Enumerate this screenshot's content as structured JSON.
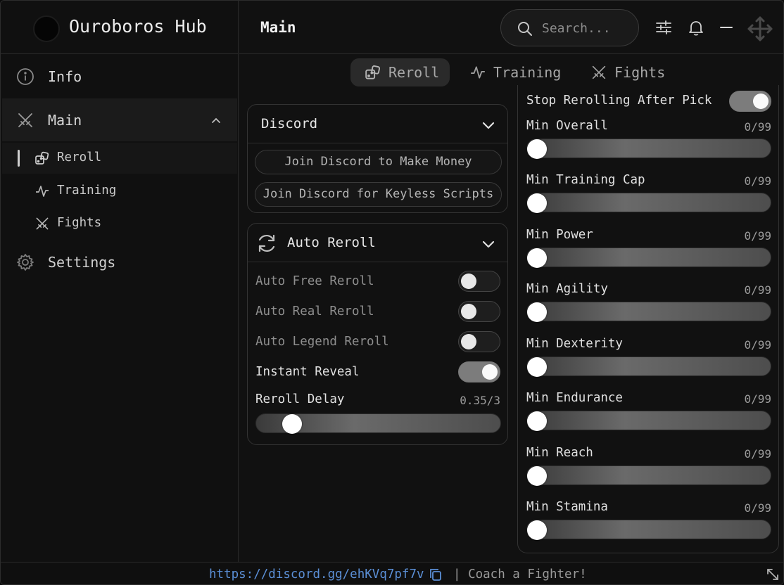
{
  "app": {
    "title": "Ouroboros Hub"
  },
  "header": {
    "title": "Main",
    "search_placeholder": "Search..."
  },
  "sidebar": {
    "items": [
      {
        "label": "Info"
      },
      {
        "label": "Main"
      },
      {
        "label": "Settings"
      }
    ],
    "sub_items": [
      {
        "label": "Reroll"
      },
      {
        "label": "Training"
      },
      {
        "label": "Fights"
      }
    ]
  },
  "tabs": [
    {
      "label": "Reroll",
      "active": true
    },
    {
      "label": "Training"
    },
    {
      "label": "Fights"
    }
  ],
  "discord_panel": {
    "title": "Discord",
    "buttons": [
      "Join Discord to Make Money",
      "Join Discord for Keyless Scripts"
    ]
  },
  "auto_reroll_panel": {
    "title": "Auto Reroll",
    "toggles": [
      {
        "label": "Auto Free Reroll",
        "on": false
      },
      {
        "label": "Auto Real Reroll",
        "on": false
      },
      {
        "label": "Auto Legend Reroll",
        "on": false
      },
      {
        "label": "Instant Reveal",
        "on": true
      }
    ],
    "slider": {
      "label": "Reroll Delay",
      "value_text": "0.35/3",
      "value": 0.35,
      "max": 3
    }
  },
  "right_panel": {
    "stop_toggle": {
      "label": "Stop Rerolling After Pick",
      "on": true
    },
    "sliders": [
      {
        "label": "Min Overall",
        "value_text": "0/99",
        "value": 0,
        "max": 99
      },
      {
        "label": "Min Training Cap",
        "value_text": "0/99",
        "value": 0,
        "max": 99
      },
      {
        "label": "Min Power",
        "value_text": "0/99",
        "value": 0,
        "max": 99
      },
      {
        "label": "Min Agility",
        "value_text": "0/99",
        "value": 0,
        "max": 99
      },
      {
        "label": "Min Dexterity",
        "value_text": "0/99",
        "value": 0,
        "max": 99
      },
      {
        "label": "Min Endurance",
        "value_text": "0/99",
        "value": 0,
        "max": 99
      },
      {
        "label": "Min Reach",
        "value_text": "0/99",
        "value": 0,
        "max": 99
      },
      {
        "label": "Min Stamina",
        "value_text": "0/99",
        "value": 0,
        "max": 99
      }
    ]
  },
  "footer": {
    "link": "https://discord.gg/ehKVq7pf7v",
    "note": "| Coach a Fighter!"
  }
}
